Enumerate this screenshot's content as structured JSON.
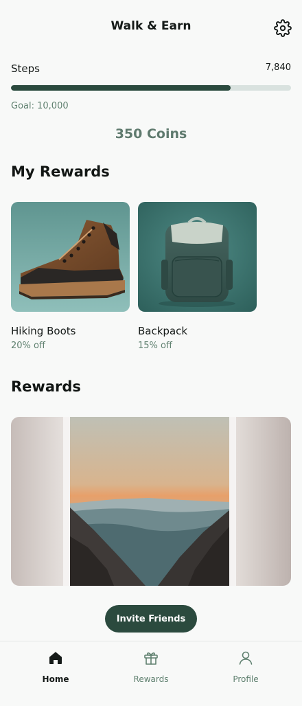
{
  "header": {
    "title": "Walk & Earn",
    "settings_icon": "gear-icon"
  },
  "steps": {
    "label": "Steps",
    "count": "7,840",
    "goal_text": "Goal: 10,000",
    "progress_fraction": 0.784
  },
  "coins": {
    "text": "350 Coins"
  },
  "my_rewards": {
    "title": "My Rewards",
    "items": [
      {
        "name": "Hiking Boots",
        "discount": "20% off"
      },
      {
        "name": "Backpack",
        "discount": "15% off"
      }
    ]
  },
  "rewards": {
    "title": "Rewards"
  },
  "invite": {
    "label": "Invite Friends"
  },
  "nav": {
    "items": [
      {
        "label": "Home",
        "icon": "home-icon",
        "active": true
      },
      {
        "label": "Rewards",
        "icon": "gift-icon",
        "active": false
      },
      {
        "label": "Profile",
        "icon": "user-icon",
        "active": false
      }
    ]
  },
  "colors": {
    "accent": "#2b4a3e",
    "muted": "#5f806f",
    "track": "#d9e2df",
    "background": "#f8f9f8"
  }
}
